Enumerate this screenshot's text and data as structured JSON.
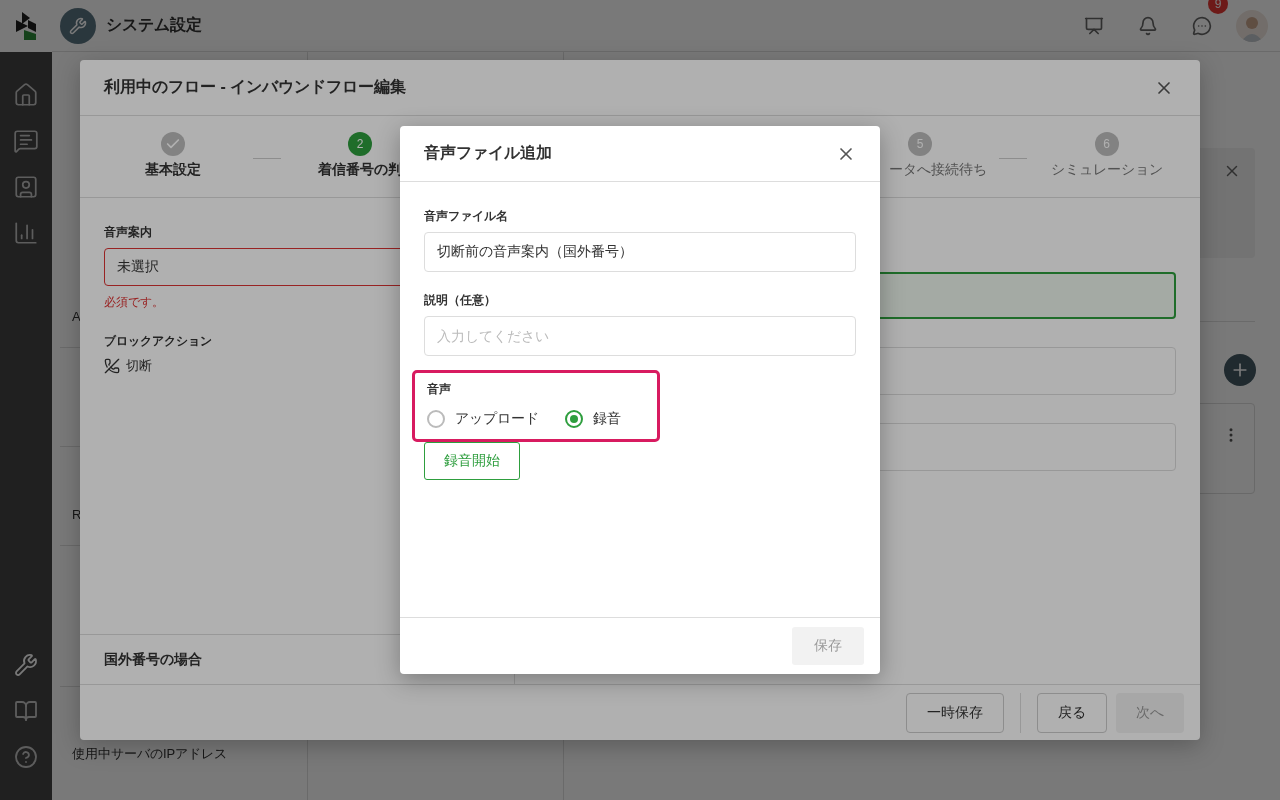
{
  "rail": {
    "items": [
      {
        "selected": false
      },
      {
        "selected": false
      },
      {
        "selected": false
      },
      {
        "selected": false
      }
    ],
    "bottom_items": [
      {
        "selected": true
      },
      {
        "selected": false
      },
      {
        "selected": false
      }
    ]
  },
  "header": {
    "title": "システム設定",
    "chat_badge": "9"
  },
  "settings_nav": [
    {
      "items": [
        "A"
      ]
    },
    {
      "items": [
        "R"
      ]
    },
    {
      "items": [
        "使用中サーバのIPアドレス"
      ]
    }
  ],
  "flow_editor": {
    "title": "利用中のフロー - インバウンドフロー編集",
    "steps": [
      {
        "done": true,
        "current": false,
        "label": "基本設定"
      },
      {
        "done": false,
        "current": true,
        "number": "2",
        "label": "着信番号の判"
      },
      {
        "done": false,
        "current": false,
        "number": "5",
        "label": "ータへ接続待ち"
      },
      {
        "done": false,
        "current": false,
        "number": "6",
        "label": "シミュレーション"
      }
    ],
    "voice_guide": {
      "label": "音声案内",
      "value": "未選択",
      "error": "必須です。"
    },
    "block_action": {
      "label": "ブロックアクション",
      "value": "切断"
    },
    "section": "国外番号の場合",
    "buttons": [
      {
        "label": "一時保存",
        "disabled": false
      },
      {
        "label": "戻る",
        "disabled": false
      },
      {
        "label": "次へ",
        "disabled": true
      }
    ]
  },
  "dialog": {
    "title": "音声ファイル追加",
    "fields": [
      {
        "label": "音声ファイル名",
        "value": "切断前の音声案内（国外番号）"
      },
      {
        "label": "説明（任意）",
        "placeholder": "入力してください"
      }
    ],
    "audio": {
      "label": "音声",
      "highlighted": true,
      "options": [
        {
          "label": "アップロード",
          "selected": false
        },
        {
          "label": "録音",
          "selected": true
        }
      ]
    },
    "record_button": "録音開始",
    "save_button": {
      "label": "保存",
      "disabled": true
    }
  }
}
